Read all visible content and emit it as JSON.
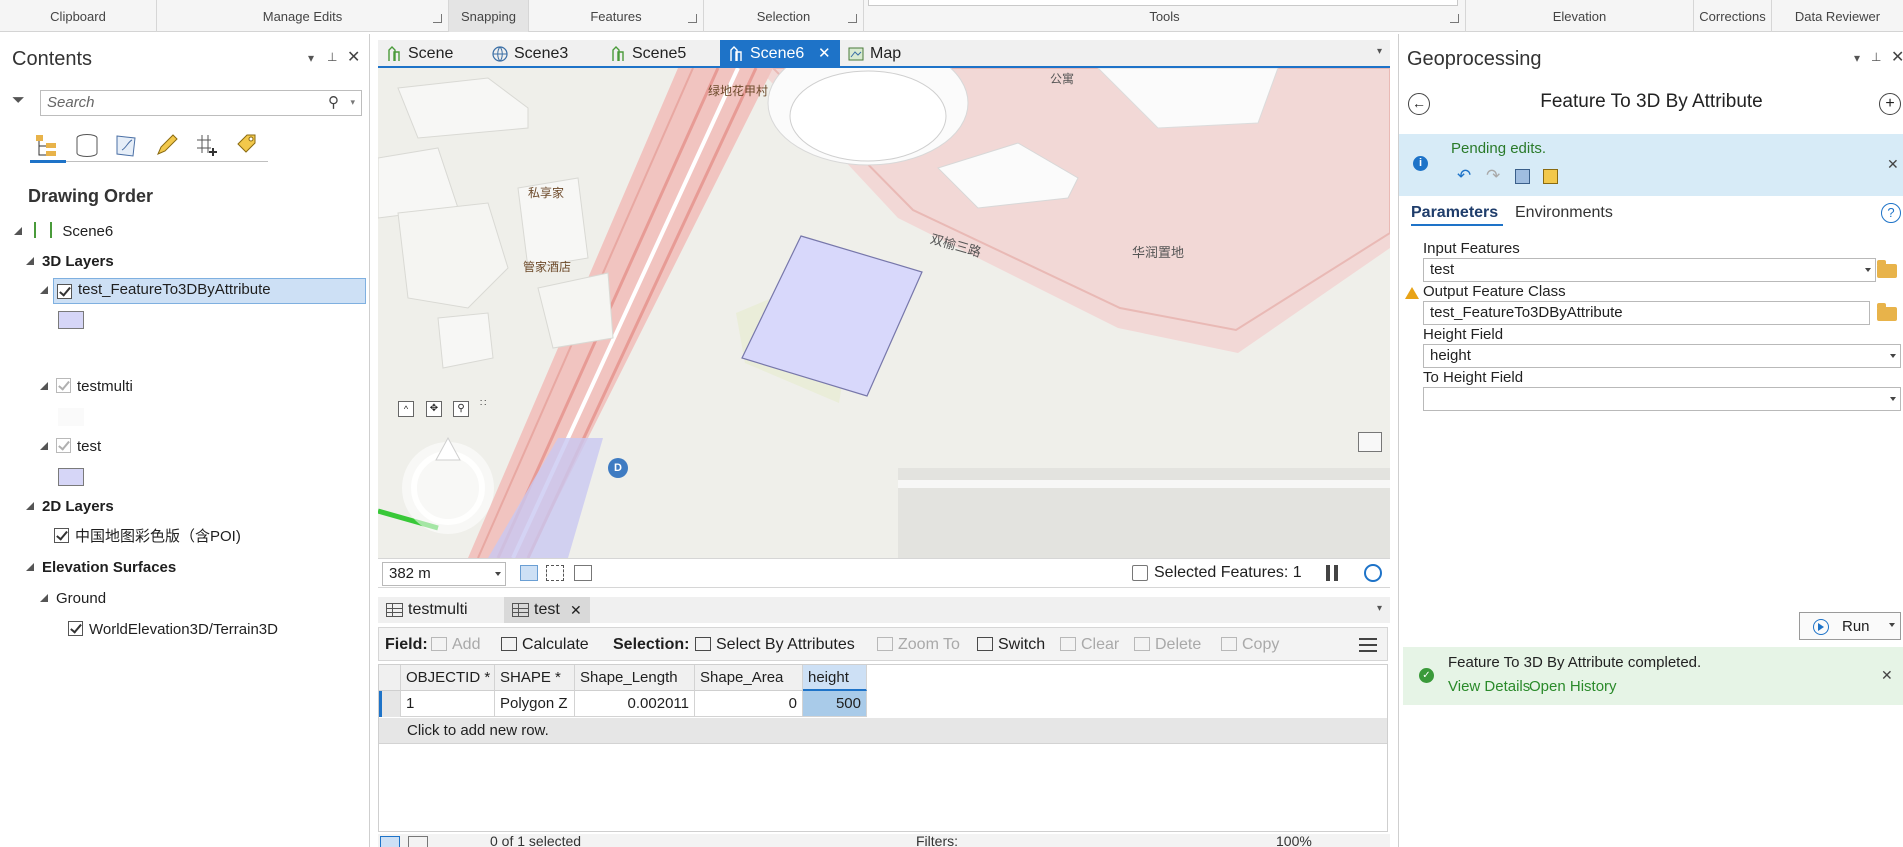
{
  "ribbon": {
    "groups": [
      "Clipboard",
      "Manage Edits",
      "Snapping",
      "Features",
      "Selection",
      "Tools",
      "Elevation",
      "Corrections",
      "Data Reviewer"
    ]
  },
  "contents": {
    "title": "Contents",
    "search_placeholder": "Search",
    "drawing_order": "Drawing Order",
    "scene": "Scene6",
    "group_3d": "3D Layers",
    "layer1": "test_FeatureTo3DByAttribute",
    "layer2": "testmulti",
    "layer3": "test",
    "group_2d": "2D Layers",
    "basemap": "中国地图彩色版（含POI)",
    "group_elev": "Elevation Surfaces",
    "ground": "Ground",
    "terrain": "WorldElevation3D/Terrain3D"
  },
  "view_tabs": [
    "Scene",
    "Scene3",
    "Scene5",
    "Scene6",
    "Map"
  ],
  "map": {
    "labels": {
      "l1": "绿地花甲村",
      "l2": "公寓",
      "l3": "私享家",
      "l4": "管家酒店",
      "l5": "双榆三路",
      "l6": "华润置地"
    },
    "marker": "D",
    "scale": "382 m",
    "selected_features": "Selected Features: 1"
  },
  "table_tabs": [
    "testmulti",
    "test"
  ],
  "attr_toolbar": {
    "field": "Field:",
    "add": "Add",
    "calculate": "Calculate",
    "selection": "Selection:",
    "select_by_attributes": "Select By Attributes",
    "zoom_to": "Zoom To",
    "switch": "Switch",
    "clear": "Clear",
    "delete": "Delete",
    "copy": "Copy"
  },
  "table": {
    "columns": [
      "OBJECTID *",
      "SHAPE *",
      "Shape_Length",
      "Shape_Area",
      "height"
    ],
    "row": [
      "1",
      "Polygon Z",
      "0.002011",
      "0",
      "500"
    ],
    "add_row": "Click to add new row."
  },
  "status": {
    "selected": "0 of 1 selected",
    "filters": "Filters:",
    "zoom": "100%"
  },
  "geo": {
    "title": "Geoprocessing",
    "tool": "Feature To 3D By Attribute",
    "pending": "Pending edits.",
    "tab_params": "Parameters",
    "tab_env": "Environments",
    "input_label": "Input  Features",
    "input_value": "test",
    "output_label": "Output Feature Class",
    "output_value": "test_FeatureTo3DByAttribute",
    "height_label": "Height Field",
    "height_value": "height",
    "to_height_label": "To Height Field",
    "to_height_value": "",
    "run": "Run",
    "completed": "Feature To 3D By Attribute completed.",
    "view_details": "View Details",
    "open_history": "Open History"
  },
  "colors": {
    "accent": "#1e73c8",
    "selection": "#cde0f5",
    "info_bar": "#d7ebf7",
    "success_bar": "#e6f4e6",
    "polygon": "#d8d8fb"
  }
}
